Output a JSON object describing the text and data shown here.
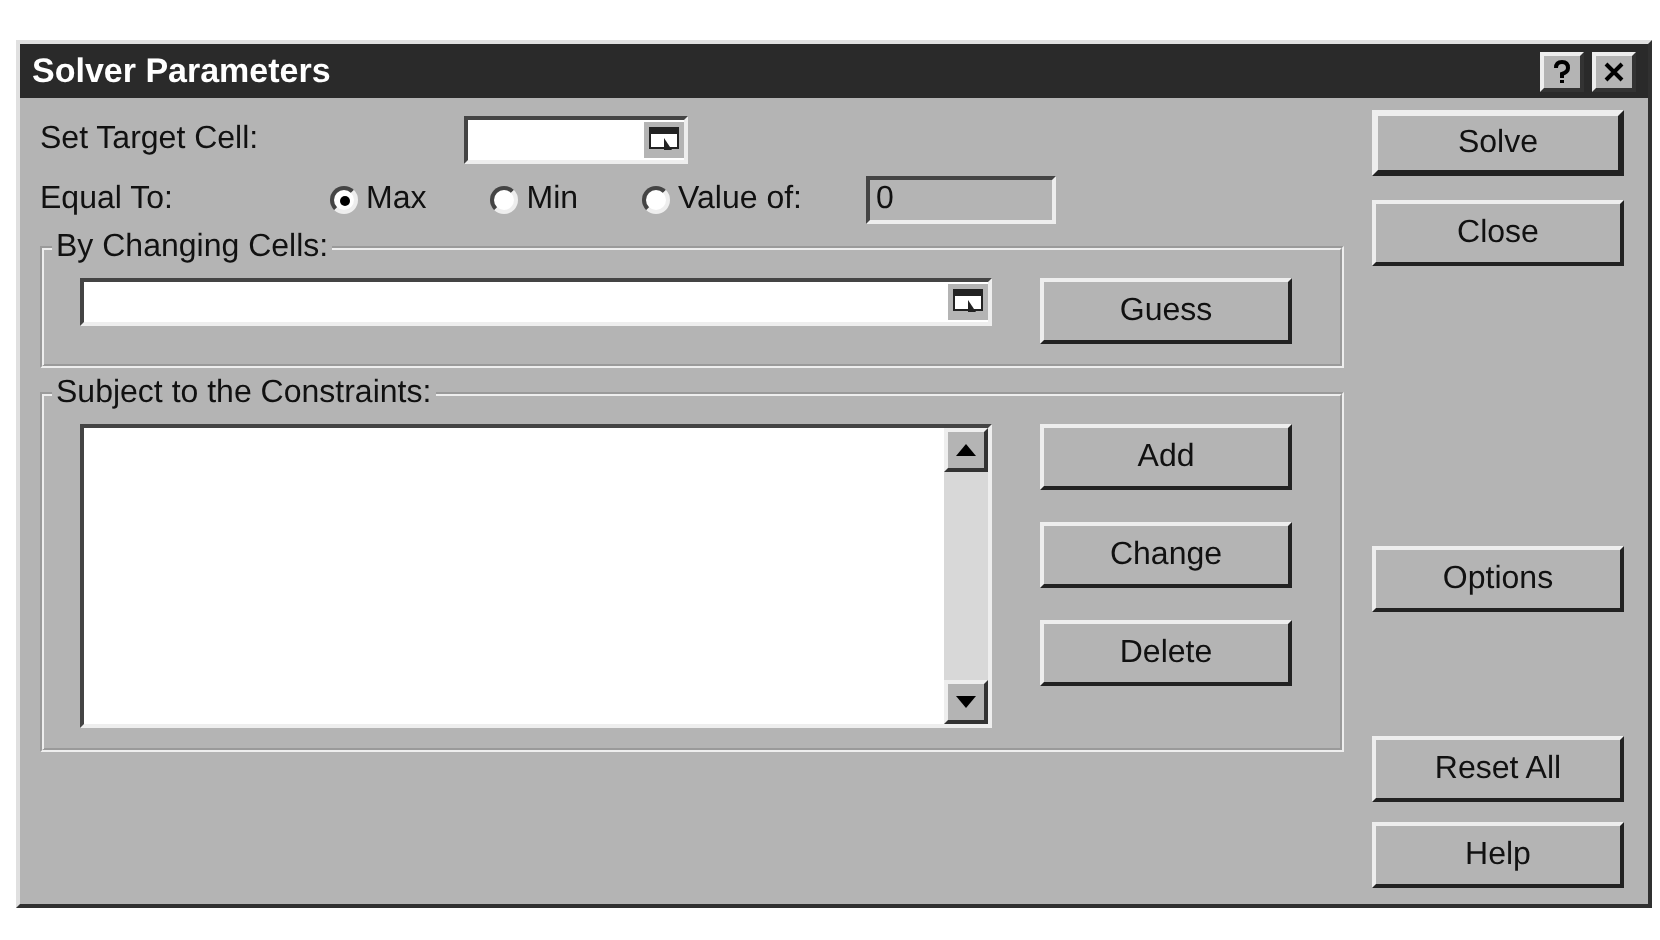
{
  "window": {
    "title": "Solver Parameters"
  },
  "target_cell": {
    "label": "Set Target Cell:"
  },
  "equal_to": {
    "label": "Equal To:",
    "value": "0",
    "options": [
      {
        "label": "Max",
        "selected": true
      },
      {
        "label": "Min",
        "selected": false
      },
      {
        "label": "Value of:",
        "selected": false
      }
    ]
  },
  "changing_cells": {
    "label": "By Changing Cells:",
    "button": "Guess"
  },
  "constraints": {
    "label": "Subject to the Constraints:",
    "buttons": [
      "Add",
      "Change",
      "Delete"
    ]
  },
  "side_buttons": [
    "Solve",
    "Close",
    "Options",
    "Reset All",
    "Help"
  ]
}
